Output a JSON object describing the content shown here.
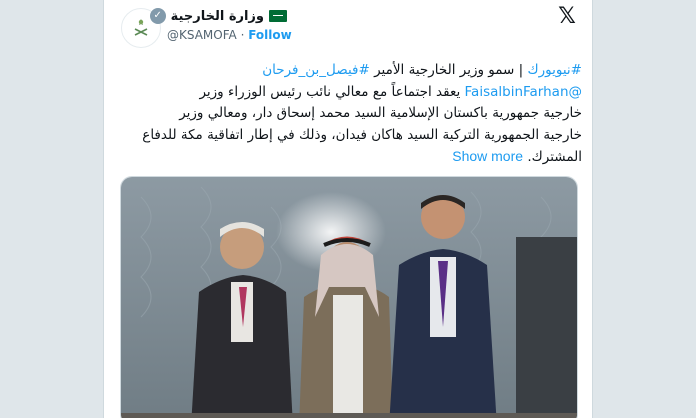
{
  "header": {
    "author_name": "وزارة الخارجية",
    "handle": "@KSAMOFA",
    "separator": "·",
    "follow_label": "Follow"
  },
  "tweet": {
    "line1_hashtag1": "#نيويورك",
    "line1_text": " | سمو وزير الخارجية الأمير ",
    "line1_hashtag2": "#فيصل_بن_فرحان",
    "line2_mention": "@FaisalbinFarhan",
    "line2_text": " يعقد اجتماعاً مع معالي نائب رئيس الوزراء وزير",
    "line3_text": "خارجية جمهورية باكستان الإسلامية السيد محمد إسحاق دار، ومعالي وزير",
    "line4_text": "خارجية الجمهورية التركية السيد هاكان فيدان، وذلك في إطار اتفاقية مكة للدفاع",
    "line5_text": "المشترك.",
    "show_more": "Show more"
  },
  "colors": {
    "link": "#1d9bf0",
    "text": "#0f1419",
    "muted": "#536471",
    "saudi_green": "#006c35"
  },
  "icons": {
    "x_logo": "x-logo-icon",
    "verified": "verified-badge-icon",
    "flag": "saudi-flag-icon"
  }
}
